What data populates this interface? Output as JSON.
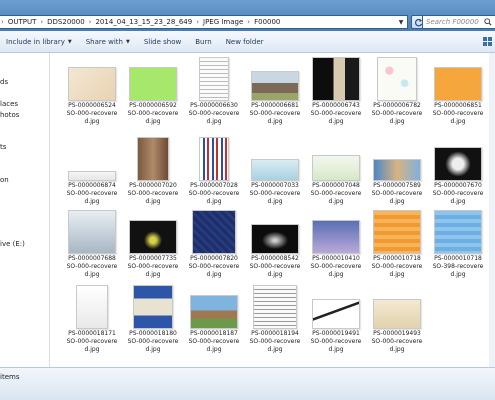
{
  "address": {
    "crumbs": [
      "OUTPUT",
      "DDS20000",
      "2014_04_13_15_23_28_649",
      "JPEG Image",
      "F00000"
    ],
    "search_placeholder": "Search F00000"
  },
  "toolbar": {
    "include_in_library": "Include in library",
    "share_with": "Share with",
    "slide_show": "Slide show",
    "burn": "Burn",
    "new_folder": "New folder"
  },
  "nav": {
    "items": [
      "ds",
      "laces",
      "hotos",
      "ts",
      "on",
      "ive (E:)"
    ]
  },
  "status": {
    "items_text": "items"
  },
  "files": [
    {
      "name": "PS-0000006524",
      "sub": "SO-000-recovere",
      "ext": "d.jpg"
    },
    {
      "name": "PS-0000006592",
      "sub": "SO-000-recovere",
      "ext": "d.jpg"
    },
    {
      "name": "PS-0000006630",
      "sub": "SO-000-recovere",
      "ext": "d.jpg"
    },
    {
      "name": "PS-0000006681",
      "sub": "SO-000-recovere",
      "ext": "d.jpg"
    },
    {
      "name": "PS-0000006743",
      "sub": "SO-000-recovere",
      "ext": "d.jpg"
    },
    {
      "name": "PS-0000006782",
      "sub": "SO-000-recovere",
      "ext": "d.jpg"
    },
    {
      "name": "PS-0000006851",
      "sub": "SO-000-recovere",
      "ext": "d.jpg"
    },
    {
      "name": "PS-0000006874",
      "sub": "SO-000-recovere",
      "ext": "d.jpg"
    },
    {
      "name": "PS-0000007020",
      "sub": "SO-000-recovere",
      "ext": "d.jpg"
    },
    {
      "name": "PS-0000007028",
      "sub": "SO-000-recovere",
      "ext": "d.jpg"
    },
    {
      "name": "PS-0000007033",
      "sub": "SO-000-recovere",
      "ext": "d.jpg"
    },
    {
      "name": "PS-0000007048",
      "sub": "SO-000-recovere",
      "ext": "d.jpg"
    },
    {
      "name": "PS-0000007589",
      "sub": "SO-000-recovere",
      "ext": "d.jpg"
    },
    {
      "name": "PS-0000007670",
      "sub": "SO-000-recovere",
      "ext": "d.jpg"
    },
    {
      "name": "PS-0000007688",
      "sub": "SO-000-recovere",
      "ext": "d.jpg"
    },
    {
      "name": "PS-0000007735",
      "sub": "SO-000-recovere",
      "ext": "d.jpg"
    },
    {
      "name": "PS-0000007820",
      "sub": "SO-000-recovere",
      "ext": "d.jpg"
    },
    {
      "name": "PS-0000008542",
      "sub": "SO-000-recovere",
      "ext": "d.jpg"
    },
    {
      "name": "PS-0000010410",
      "sub": "SO-000-recovere",
      "ext": "d.jpg"
    },
    {
      "name": "PS-0000010718",
      "sub": "SO-000-recovere",
      "ext": "d.jpg"
    },
    {
      "name": "PS-0000010718",
      "sub": "SO-398-recovere",
      "ext": "d.jpg"
    },
    {
      "name": "PS-0000018171",
      "sub": "SO-000-recovere",
      "ext": "d.jpg"
    },
    {
      "name": "PS-0000018180",
      "sub": "SO-000-recovere",
      "ext": "d.jpg"
    },
    {
      "name": "PS-0000018187",
      "sub": "SO-000-recovere",
      "ext": "d.jpg"
    },
    {
      "name": "PS-0000018194",
      "sub": "SO-000-recovere",
      "ext": "d.jpg"
    },
    {
      "name": "PS-0000019491",
      "sub": "SO-000-recovere",
      "ext": "d.jpg"
    },
    {
      "name": "PS-0000019493",
      "sub": "SO-000-recovere",
      "ext": "d.jpg"
    }
  ]
}
